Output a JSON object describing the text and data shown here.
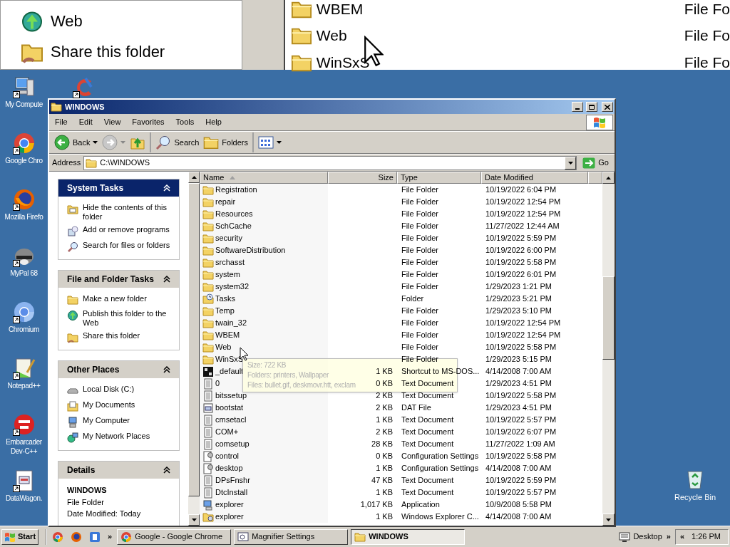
{
  "magnifier": {
    "left_items": [
      {
        "label": "Web",
        "kind": "publish"
      },
      {
        "label": "Share this folder",
        "kind": "share"
      }
    ],
    "right_rows": [
      {
        "name": "WBEM",
        "type": "File Fo"
      },
      {
        "name": "Web",
        "type": "File Fo"
      },
      {
        "name": "WinSxS",
        "type": "File Fo"
      }
    ]
  },
  "desktop_icons": [
    {
      "label": "My Compute",
      "kind": "computer"
    },
    {
      "label": "Google Chro",
      "kind": "chrome"
    },
    {
      "label": "Mozilla Firefo",
      "kind": "firefox"
    },
    {
      "label": "MyPal 68",
      "kind": "mypal"
    },
    {
      "label": "Chromium",
      "kind": "chromium"
    },
    {
      "label": "Notepad++",
      "kind": "notepad"
    },
    {
      "label": "Embarcader\nDev-C++",
      "kind": "devcpp"
    },
    {
      "label": "DataWagon.",
      "kind": "datawagon"
    }
  ],
  "extra_icon": {
    "kind": "ccleaner"
  },
  "recycle_bin": {
    "label": "Recycle Bin"
  },
  "window": {
    "title": "WINDOWS",
    "menu": [
      "File",
      "Edit",
      "View",
      "Favorites",
      "Tools",
      "Help"
    ],
    "toolbar": [
      {
        "kind": "back",
        "label": "Back",
        "dropdown": true,
        "disabled": false,
        "separator_before": false
      },
      {
        "kind": "forward",
        "dropdown": true,
        "disabled": true,
        "separator_before": false
      },
      {
        "kind": "up",
        "dropdown": false,
        "disabled": false,
        "separator_before": false
      },
      {
        "kind": "search",
        "label": "Search",
        "dropdown": false,
        "disabled": false,
        "separator_before": true
      },
      {
        "kind": "folders",
        "label": "Folders",
        "dropdown": false,
        "disabled": false,
        "separator_before": false
      },
      {
        "kind": "views",
        "dropdown": true,
        "disabled": false,
        "separator_before": true
      }
    ],
    "address": {
      "label": "Address",
      "value": "C:\\WINDOWS",
      "go": "Go"
    },
    "task_panes": [
      {
        "title": "System Tasks",
        "kind": "special",
        "expanded": true,
        "items": [
          {
            "label": "Hide the contents of this folder",
            "kind": "hide"
          },
          {
            "label": "Add or remove programs",
            "kind": "addremove"
          },
          {
            "label": "Search for files or folders",
            "kind": "search"
          }
        ]
      },
      {
        "title": "File and Folder Tasks",
        "kind": "normal",
        "expanded": true,
        "items": [
          {
            "label": "Make a new folder",
            "kind": "newfolder"
          },
          {
            "label": "Publish this folder to the Web",
            "kind": "publish"
          },
          {
            "label": "Share this folder",
            "kind": "share"
          }
        ]
      },
      {
        "title": "Other Places",
        "kind": "normal",
        "expanded": true,
        "items": [
          {
            "label": "Local Disk (C:)",
            "kind": "disk"
          },
          {
            "label": "My Documents",
            "kind": "documents"
          },
          {
            "label": "My Computer",
            "kind": "computer"
          },
          {
            "label": "My Network Places",
            "kind": "network"
          }
        ]
      },
      {
        "title": "Details",
        "kind": "details",
        "expanded": true,
        "name": "WINDOWS",
        "lines": [
          "File Folder",
          "Date Modified: Today"
        ]
      }
    ],
    "columns": [
      {
        "label": "Name",
        "sorted": true
      },
      {
        "label": "Size",
        "sorted": false
      },
      {
        "label": "Type",
        "sorted": false
      },
      {
        "label": "Date Modified",
        "sorted": false
      }
    ],
    "rows": [
      {
        "name": "Registration",
        "kind": "folder",
        "size": "",
        "type": "File Folder",
        "date": "10/19/2022 6:04 PM"
      },
      {
        "name": "repair",
        "kind": "folder",
        "size": "",
        "type": "File Folder",
        "date": "10/19/2022 12:54 PM"
      },
      {
        "name": "Resources",
        "kind": "folder",
        "size": "",
        "type": "File Folder",
        "date": "10/19/2022 12:54 PM"
      },
      {
        "name": "SchCache",
        "kind": "folder",
        "size": "",
        "type": "File Folder",
        "date": "11/27/2022 12:44 AM"
      },
      {
        "name": "security",
        "kind": "folder",
        "size": "",
        "type": "File Folder",
        "date": "10/19/2022 5:59 PM"
      },
      {
        "name": "SoftwareDistribution",
        "kind": "folder",
        "size": "",
        "type": "File Folder",
        "date": "10/19/2022 6:00 PM"
      },
      {
        "name": "srchasst",
        "kind": "folder",
        "size": "",
        "type": "File Folder",
        "date": "10/19/2022 5:58 PM"
      },
      {
        "name": "system",
        "kind": "folder",
        "size": "",
        "type": "File Folder",
        "date": "10/19/2022 6:01 PM"
      },
      {
        "name": "system32",
        "kind": "folder",
        "size": "",
        "type": "File Folder",
        "date": "1/29/2023 1:21 PM"
      },
      {
        "name": "Tasks",
        "kind": "tasks",
        "size": "",
        "type": "Folder",
        "date": "1/29/2023 5:21 PM"
      },
      {
        "name": "Temp",
        "kind": "folder",
        "size": "",
        "type": "File Folder",
        "date": "1/29/2023 5:10 PM"
      },
      {
        "name": "twain_32",
        "kind": "folder",
        "size": "",
        "type": "File Folder",
        "date": "10/19/2022 12:54 PM"
      },
      {
        "name": "WBEM",
        "kind": "folder",
        "size": "",
        "type": "File Folder",
        "date": "10/19/2022 12:54 PM"
      },
      {
        "name": "Web",
        "kind": "folder",
        "size": "",
        "type": "File Folder",
        "date": "10/19/2022 5:58 PM"
      },
      {
        "name": "WinSxS",
        "kind": "folder",
        "size": "",
        "type": "File Folder",
        "date": "1/29/2023 5:15 PM"
      },
      {
        "name": "_default",
        "kind": "msdos",
        "size": "1 KB",
        "type": "Shortcut to MS-DOS...",
        "date": "4/14/2008 7:00 AM"
      },
      {
        "name": "0",
        "kind": "text",
        "size": "0 KB",
        "type": "Text Document",
        "date": "1/29/2023 4:51 PM"
      },
      {
        "name": "bitssetup",
        "kind": "text",
        "size": "2 KB",
        "type": "Text Document",
        "date": "10/19/2022 5:58 PM"
      },
      {
        "name": "bootstat",
        "kind": "dat",
        "size": "2 KB",
        "type": "DAT File",
        "date": "1/29/2023 4:51 PM"
      },
      {
        "name": "cmsetacl",
        "kind": "text",
        "size": "1 KB",
        "type": "Text Document",
        "date": "10/19/2022 5:57 PM"
      },
      {
        "name": "COM+",
        "kind": "text",
        "size": "2 KB",
        "type": "Text Document",
        "date": "10/19/2022 6:07 PM"
      },
      {
        "name": "comsetup",
        "kind": "text",
        "size": "28 KB",
        "type": "Text Document",
        "date": "11/27/2022 1:09 AM"
      },
      {
        "name": "control",
        "kind": "config",
        "size": "0 KB",
        "type": "Configuration Settings",
        "date": "10/19/2022 5:58 PM"
      },
      {
        "name": "desktop",
        "kind": "config",
        "size": "1 KB",
        "type": "Configuration Settings",
        "date": "4/14/2008 7:00 AM"
      },
      {
        "name": "DPsFnshr",
        "kind": "text",
        "size": "47 KB",
        "type": "Text Document",
        "date": "10/19/2022 5:59 PM"
      },
      {
        "name": "DtcInstall",
        "kind": "text",
        "size": "1 KB",
        "type": "Text Document",
        "date": "10/19/2022 5:57 PM"
      },
      {
        "name": "explorer",
        "kind": "app",
        "size": "1,017 KB",
        "type": "Application",
        "date": "10/9/2008 5:58 PM"
      },
      {
        "name": "explorer",
        "kind": "explorer",
        "size": "1 KB",
        "type": "Windows Explorer C...",
        "date": "4/14/2008 7:00 AM"
      }
    ],
    "tooltip": {
      "lines": [
        "Size: 722 KB",
        "Folders: printers, Wallpaper",
        "Files: bullet.gif, deskmovr.htt, exclam"
      ]
    }
  },
  "taskbar": {
    "start": "Start",
    "quick_launch": [
      {
        "kind": "chrome"
      },
      {
        "kind": "firefox"
      },
      {
        "kind": "app"
      }
    ],
    "more": "»",
    "tasks": [
      {
        "label": "Google - Google Chrome",
        "kind": "chrome",
        "selected": false
      },
      {
        "label": "Magnifier Settings",
        "kind": "magnifier",
        "selected": false
      },
      {
        "label": "WINDOWS",
        "kind": "folder",
        "selected": true
      }
    ],
    "desktop_toolbar": {
      "label": "Desktop",
      "more": "»"
    },
    "tray": {
      "expand": "«",
      "clock": "1:26 PM"
    }
  }
}
